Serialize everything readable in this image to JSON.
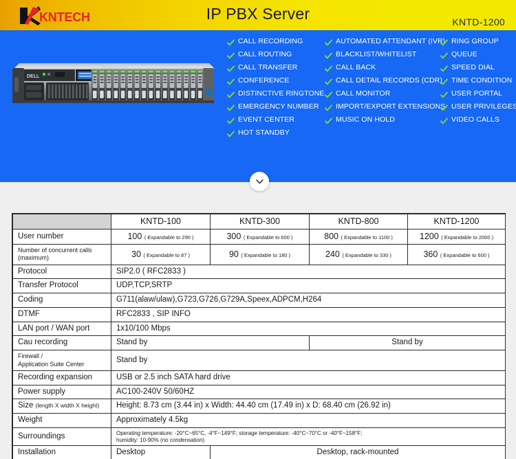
{
  "header": {
    "logo_text": "KNTECH",
    "logo_icon": "kntech-k-logo",
    "title": "IP PBX Server",
    "model": "KNTD-1200"
  },
  "hero": {
    "product_image": "dell-rack-server-photo",
    "background_color": "#1668f5",
    "check_color": "#7fd23c",
    "feature_columns": [
      [
        "CALL RECORDING",
        "CALL ROUTING",
        "CALL TRANSFER",
        "CONFERENCE",
        "DISTINCTIVE RINGTONE",
        "EMERGENCY NUMBER",
        "EVENT CENTER",
        "HOT STANDBY"
      ],
      [
        "AUTOMATED ATTENDANT (IVR)",
        "BLACKLIST/WHITELIST",
        "CALL BACK",
        "CALL DETAIL RECORDS (CDR)",
        "CALL MONITOR",
        "IMPORT/EXPORT EXTENSIONS",
        "MUSIC ON HOLD"
      ],
      [
        "RING GROUP",
        "QUEUE",
        "SPEED DIAL",
        "TIME CONDITION",
        "USER PORTAL",
        "USER PRIVILEGES",
        "VIDEO CALLS"
      ]
    ]
  },
  "scroll_button": {
    "icon": "chevron-down-icon",
    "label": ""
  },
  "spec_table": {
    "columns": [
      "",
      "KNTD-100",
      "KNTD-300",
      "KNTD-800",
      "KNTD-1200"
    ],
    "rows": {
      "user_number": {
        "label": "User number",
        "kntd100_value": "100",
        "kntd100_note": "( Expandable to 290 )",
        "kntd300_value": "300",
        "kntd300_note": "( Expandable to 600 )",
        "kntd800_value": "800",
        "kntd800_note": "( Expandable to 1100 )",
        "kntd1200_value": "1200",
        "kntd1200_note": "( Expandable to 2000 )"
      },
      "concurrent_calls": {
        "label": "Number of concurrent calls (maximum)",
        "label_line1": "Number of concurrent calls",
        "label_line2": "(maximum)",
        "kntd100_value": "30",
        "kntd100_note": "( Expandable to 87 )",
        "kntd300_value": "90",
        "kntd300_note": "( Expandable to 180 )",
        "kntd800_value": "240",
        "kntd800_note": "( Expandable to 330 )",
        "kntd1200_value": "360",
        "kntd1200_note": "( Expandable to 600 )"
      },
      "protocol": {
        "label": "Protocol",
        "value": "SIP2.0  ( RFC2833 )"
      },
      "transfer_protocol": {
        "label": "Transfer Protocol",
        "value": "UDP,TCP,SRTP"
      },
      "coding": {
        "label": "Coding",
        "value": "G711(alaw/ulaw),G723,G726,G729A,Speex,ADPCM,H264"
      },
      "dtmf": {
        "label": "DTMF",
        "value": "RFC2833 ,  SIP INFO"
      },
      "lan_wan": {
        "label": "LAN port / WAN port",
        "value": "1x10/100 Mbps"
      },
      "cau_recording": {
        "label": "Cau recording",
        "value_left": "Stand by",
        "value_right": "Stand by"
      },
      "firewall": {
        "label": "Firewall / Application Suite Center",
        "label_line1": "Firewall /",
        "label_line2": "Application Suite Center",
        "value": "Stand by"
      },
      "recording_expansion": {
        "label": "Recording expansion",
        "value": "USB or  2.5 inch SATA hard drive"
      },
      "power_supply": {
        "label": "Power supply",
        "value": "AC100-240V  50/60HZ"
      },
      "size": {
        "label": "Size",
        "label_note": "(length X width X height)",
        "value": "Height: 8.73 cm (3.44 in) x Width: 44.40 cm (17.49 in) x D: 68.40 cm (26.92 in)"
      },
      "weight": {
        "label": "Weight",
        "value": "Approximately 4.5kg"
      },
      "surroundings": {
        "label": "Surroundings",
        "value_line1": "Operating temperature: -20°C~65°C, -4°F~149°F; storage temperature: -40°C~70°C or -40°F~158°F;",
        "value_line2": "humidity: 10-90% (no condensation)"
      },
      "installation": {
        "label": "Installation",
        "value_left": "Desktop",
        "value_right": "Desktop, rack-mounted"
      }
    }
  }
}
